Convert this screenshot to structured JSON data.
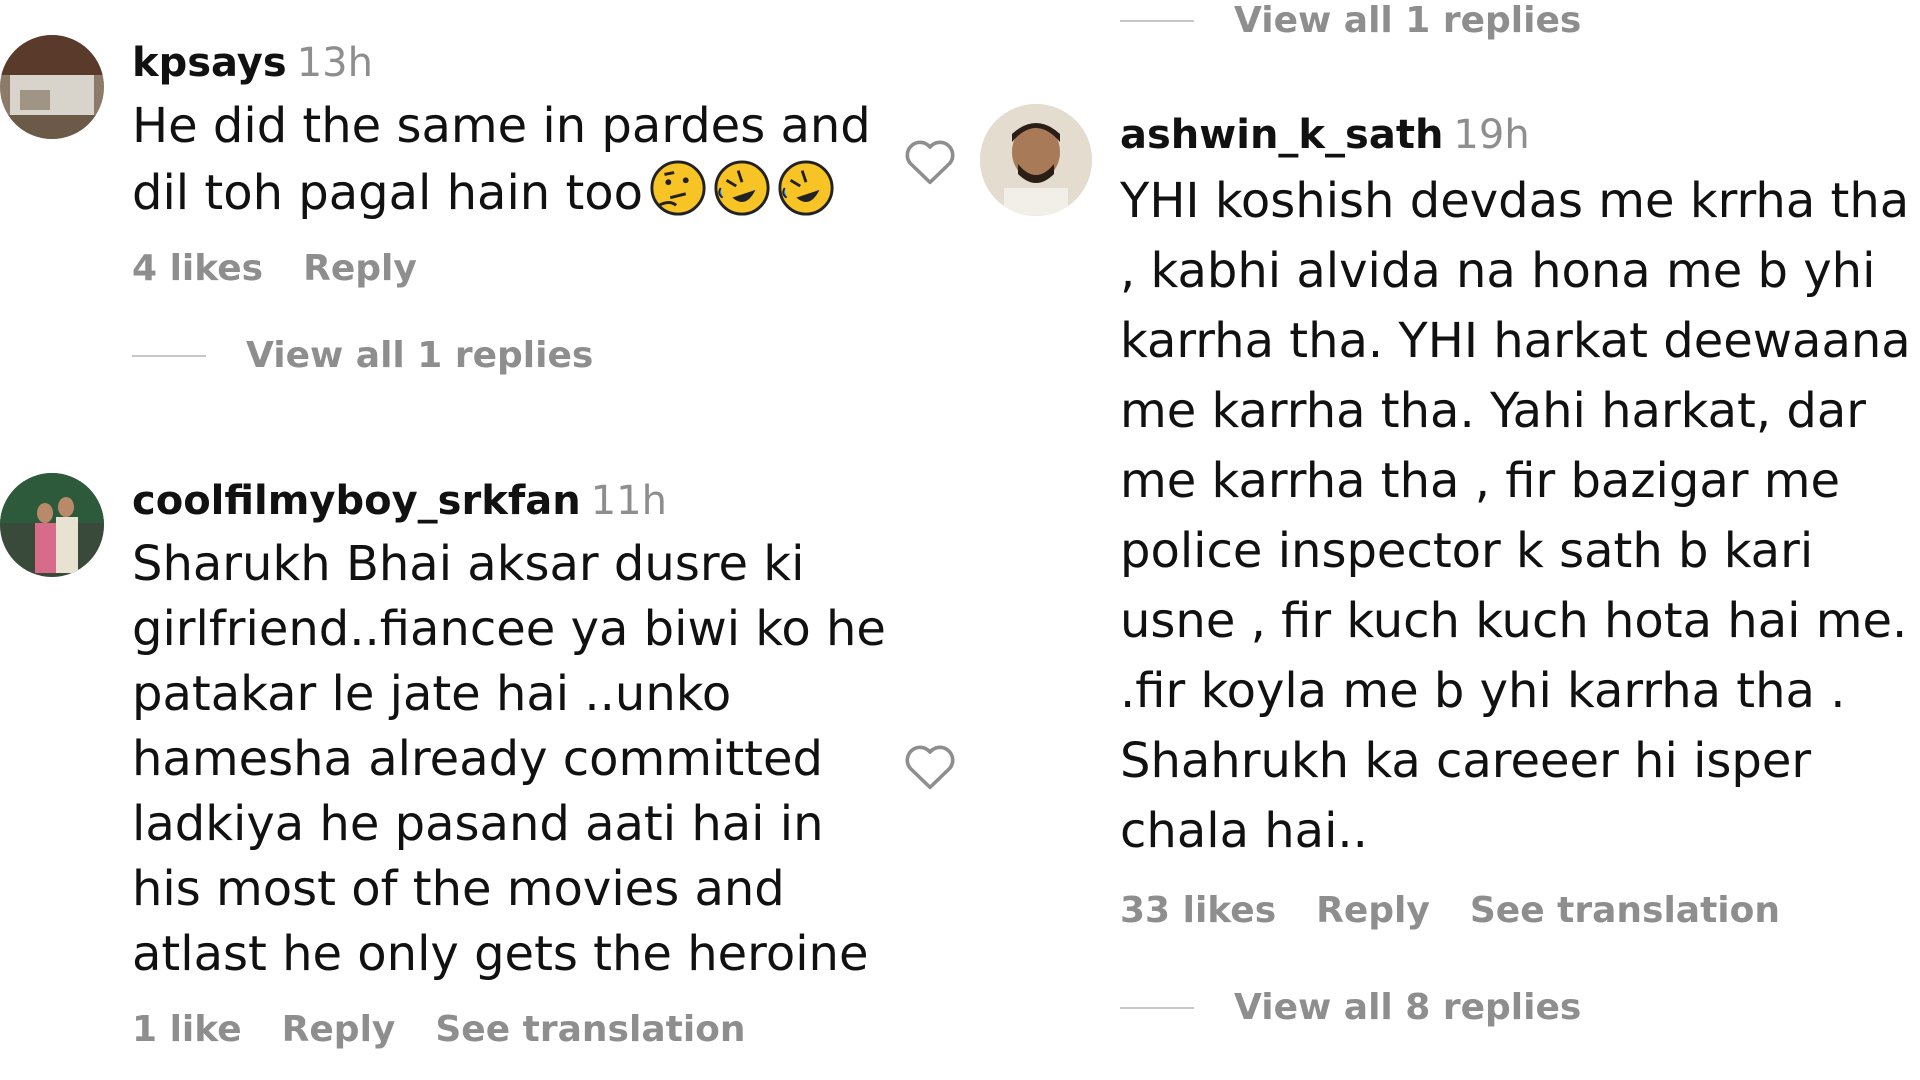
{
  "top_right_replies": "View all 1 replies",
  "comments": [
    {
      "username": "kpsays",
      "time": "13h",
      "text_lines": [
        "He did the same in pardes and",
        "dil toh pagal hain too"
      ],
      "emojis": [
        "thinking-face",
        "rolling-on-floor-laughing",
        "rolling-on-floor-laughing"
      ],
      "likes": "4 likes",
      "reply": "Reply",
      "view_replies": "View all 1 replies"
    },
    {
      "username": "coolfilmyboy_srkfan",
      "time": "11h",
      "text": "Sharukh Bhai aksar dusre ki girlfriend..fiancee ya biwi ko he patakar le jate hai ..unko hamesha already committed ladkiya he pasand aati hai in his most of the movies and atlast he only gets the heroine",
      "likes": "1 like",
      "reply": "Reply",
      "translation": "See translation"
    },
    {
      "username": "ashwin_k_sath",
      "time": "19h",
      "text": "YHI koshish devdas me krrha tha , kabhi alvida na hona me b yhi karrha tha. YHI harkat deewaana me karrha tha. Yahi harkat, dar me karrha tha , fir bazigar me police inspector k sath b kari usne , fir kuch kuch hota hai me. .fir koyla me b yhi karrha tha . Shahrukh ka careeer hi isper chala hai..",
      "likes": "33 likes",
      "reply": "Reply",
      "translation": "See translation",
      "view_replies": "View all 8 replies"
    }
  ],
  "icons": {
    "like": "heart-outline-icon"
  }
}
